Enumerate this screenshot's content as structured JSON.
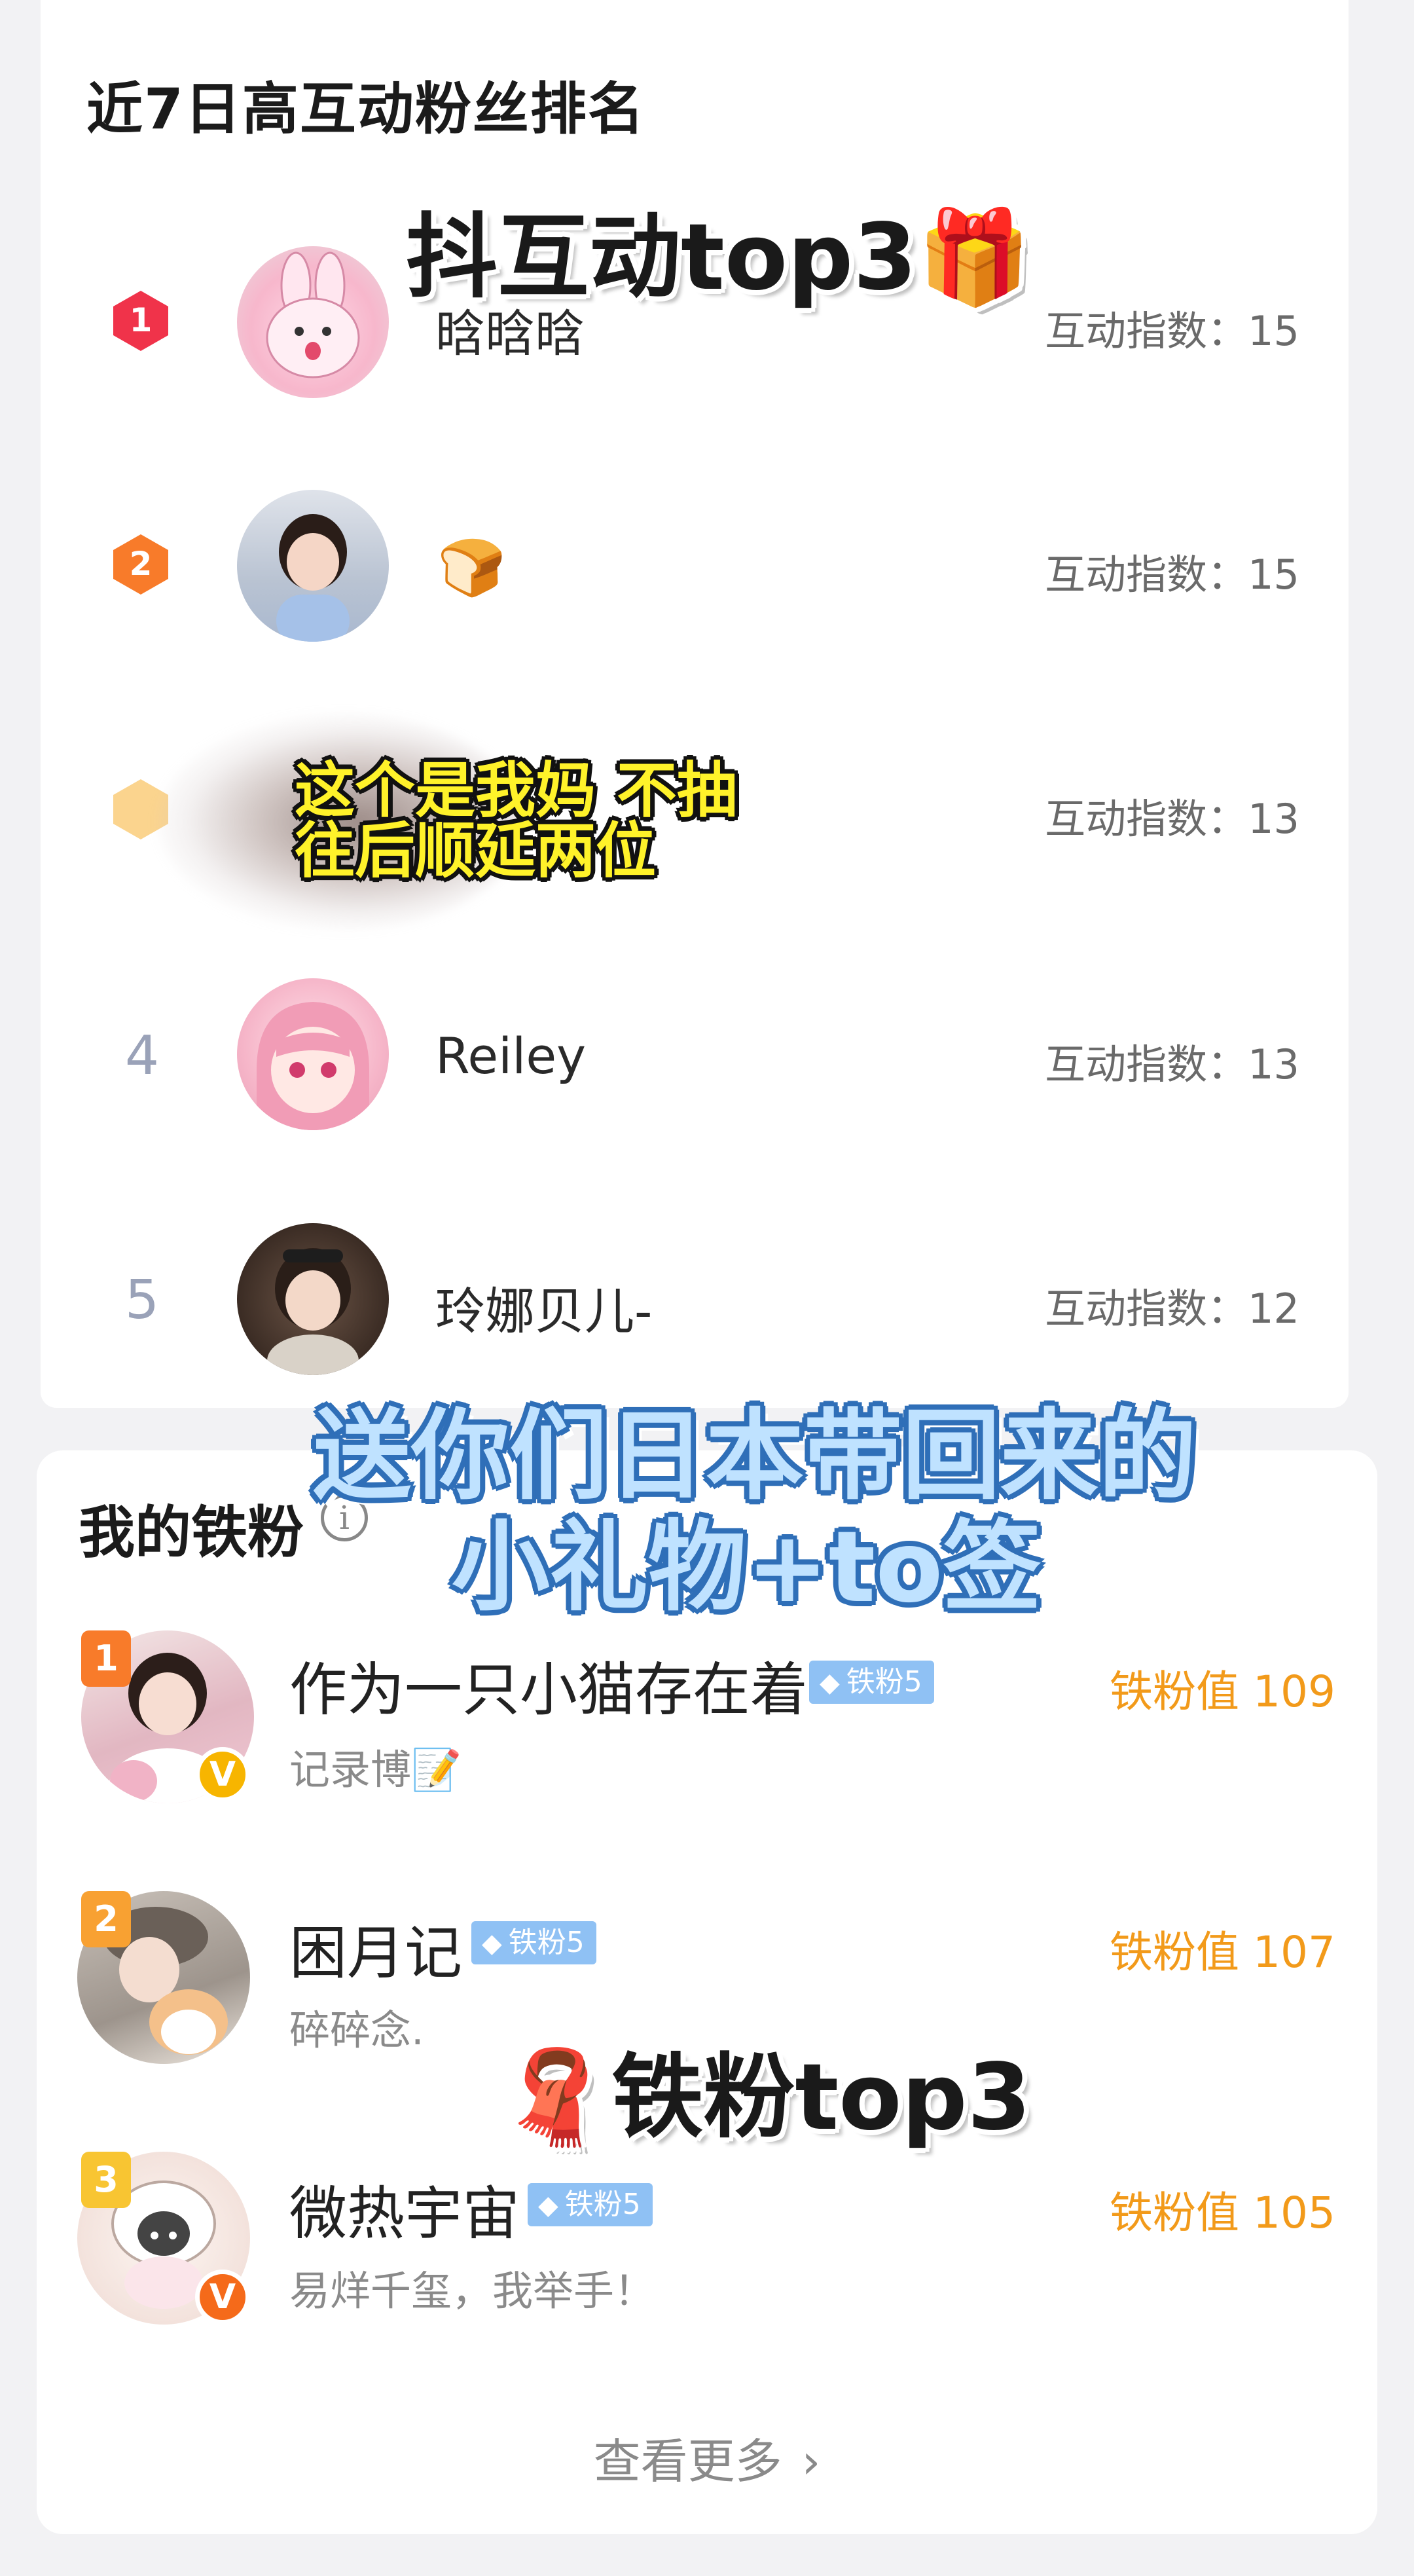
{
  "interaction_ranking": {
    "title": "近7日高互动粉丝排名",
    "score_label": "互动指数：",
    "items": [
      {
        "rank": "1",
        "name": "晗晗晗",
        "score": "15",
        "badge_color": "#f0334a"
      },
      {
        "rank": "2",
        "name": "🍞",
        "score": "15",
        "badge_color": "#f87b2a"
      },
      {
        "rank": "3",
        "name": "",
        "score": "13",
        "badge_color": "#f8b232"
      },
      {
        "rank": "4",
        "name": "Reiley",
        "score": "13"
      },
      {
        "rank": "5",
        "name": "玲娜贝儿-",
        "score": "12"
      }
    ]
  },
  "iron_fans": {
    "title": "我的铁粉",
    "info_icon": "i",
    "value_label": "铁粉值",
    "items": [
      {
        "rank": "1",
        "name": "作为一只小猫存在着",
        "level": "铁粉5",
        "subtitle": "记录博📝",
        "value": "109",
        "rank_color": "#f87b2a",
        "verify": "V",
        "verify_color": "#f7b500"
      },
      {
        "rank": "2",
        "name": "困月记",
        "level": "铁粉5",
        "subtitle": "碎碎念.",
        "value": "107",
        "rank_color": "#f8a132"
      },
      {
        "rank": "3",
        "name": "微热宇宙",
        "level": "铁粉5",
        "subtitle": "易烊千玺，我举手！",
        "value": "105",
        "rank_color": "#f8c532",
        "verify": "V",
        "verify_color": "#f56a1a"
      }
    ],
    "more_label": "查看更多",
    "more_icon": "chevron-right-icon"
  },
  "overlays": {
    "top_caption": "抖互动top3🎁",
    "middle_caption_line1": "送你们日本带回来的",
    "middle_caption_line2": "小礼物+to签",
    "note_line1": "这个是我妈 不抽",
    "note_line2": "往后顺延两位",
    "bottom_caption": "🧣铁粉top3"
  }
}
